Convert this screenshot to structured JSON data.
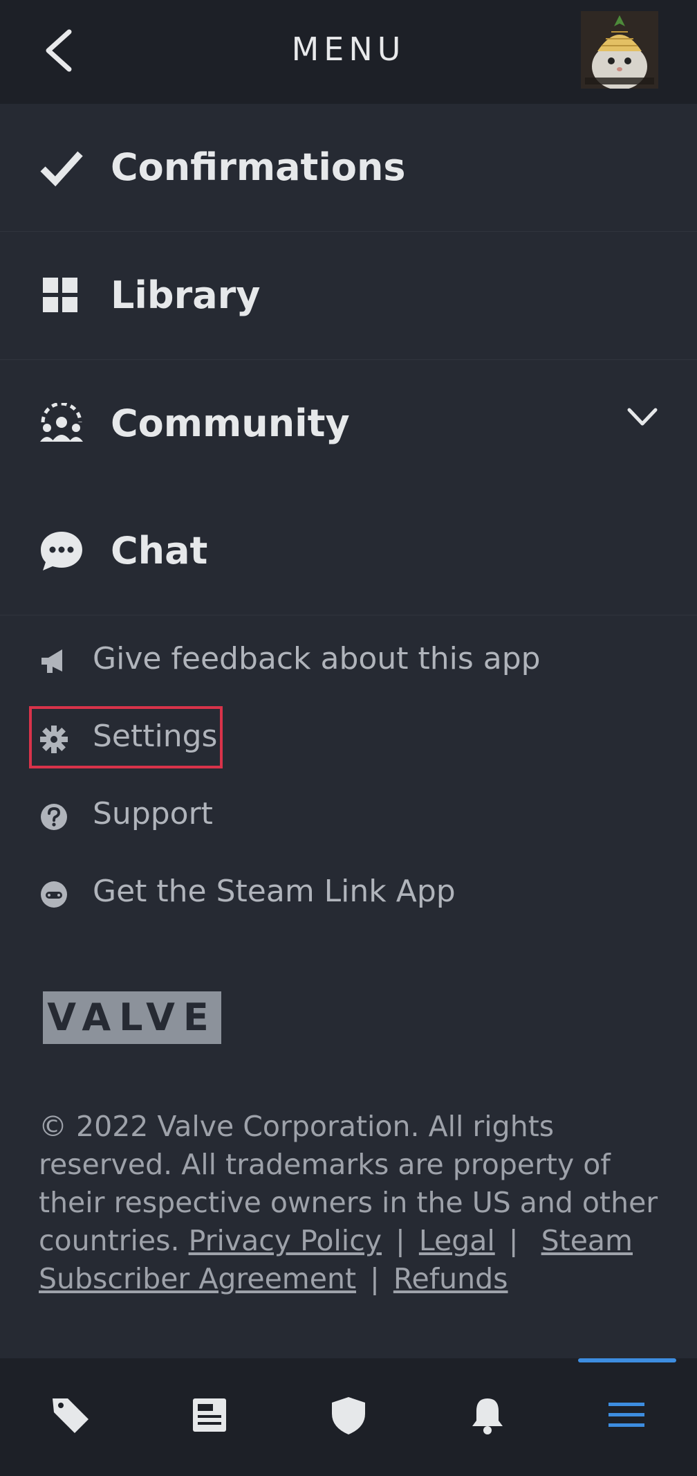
{
  "header": {
    "title": "MENU"
  },
  "main_menu": [
    {
      "label": "Confirmations",
      "icon": "checkmark-icon"
    },
    {
      "label": "Library",
      "icon": "grid-icon"
    },
    {
      "label": "Community",
      "icon": "community-icon"
    },
    {
      "label": "Chat",
      "icon": "chat-bubble-icon"
    }
  ],
  "sub_menu": [
    {
      "label": "Give feedback about this app",
      "icon": "megaphone-icon"
    },
    {
      "label": "Settings",
      "icon": "gear-icon"
    },
    {
      "label": "Support",
      "icon": "question-icon"
    },
    {
      "label": "Get the Steam Link App",
      "icon": "gamepad-icon"
    }
  ],
  "brand": {
    "logo_text": "VALVE"
  },
  "legal": {
    "text": "© 2022 Valve Corporation. All rights reserved. All trademarks are property of their respective owners in the US and other countries.",
    "privacy": "Privacy Policy",
    "legal": "Legal",
    "ssa": "Steam Subscriber Agreement",
    "refunds": "Refunds"
  },
  "bottom_nav": [
    "store-tag-icon",
    "news-icon",
    "shield-icon",
    "bell-icon",
    "hamburger-menu-icon"
  ],
  "colors": {
    "accent": "#3d8de0",
    "highlight": "#d8334a",
    "background": "#262a33",
    "bar": "#1d2027"
  }
}
